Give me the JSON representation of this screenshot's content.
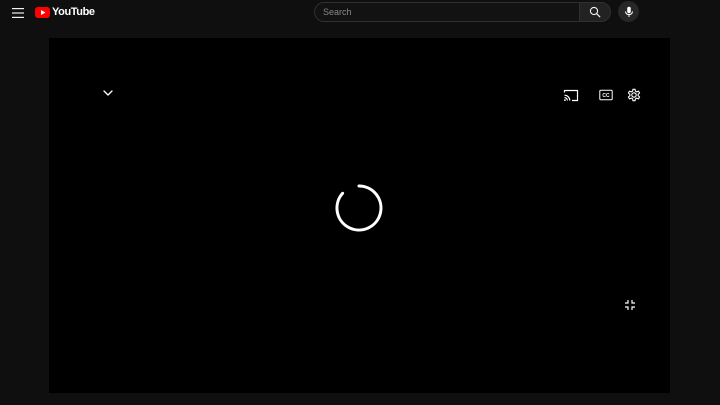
{
  "header": {
    "logo_text": "YouTube",
    "search": {
      "placeholder": "Search",
      "value": ""
    }
  },
  "icons": {
    "menu": "hamburger-menu-icon",
    "logo": "youtube-logo-icon",
    "search": "search-icon",
    "mic": "microphone-icon",
    "chevron": "chevron-down-icon",
    "cast": "cast-icon",
    "captions": "closed-captions-icon",
    "settings": "gear-icon",
    "exit_fullscreen": "exit-fullscreen-icon",
    "loading": "loading-spinner-icon"
  },
  "player": {
    "captions_label": "CC",
    "state": "loading"
  },
  "colors": {
    "background": "#0f0f0f",
    "player": "#000000",
    "brand_red": "#ff0000",
    "search_border": "#303030",
    "search_button": "#222222",
    "icon": "#ffffff"
  }
}
